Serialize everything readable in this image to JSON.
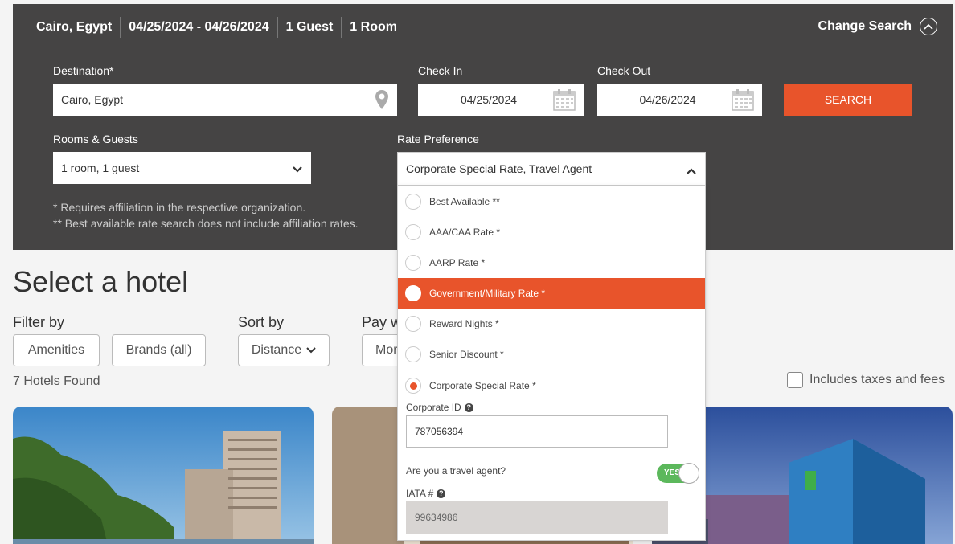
{
  "summary": {
    "location": "Cairo, Egypt",
    "dates": "04/25/2024 - 04/26/2024",
    "guests": "1 Guest",
    "rooms": "1 Room",
    "change_search": "Change Search"
  },
  "form": {
    "destination_label": "Destination*",
    "destination_value": "Cairo, Egypt",
    "checkin_label": "Check In",
    "checkin_value": "04/25/2024",
    "checkout_label": "Check Out",
    "checkout_value": "04/26/2024",
    "search_button": "SEARCH",
    "rooms_label": "Rooms & Guests",
    "rooms_value": "1 room, 1 guest",
    "rate_label": "Rate Preference",
    "rate_value": "Corporate Special Rate, Travel Agent",
    "note1": "* Requires affiliation in the respective organization.",
    "note2": "** Best available rate search does not include affiliation rates."
  },
  "rate_options": [
    {
      "label": "Best Available **",
      "state": "unchecked"
    },
    {
      "label": "AAA/CAA Rate *",
      "state": "unchecked"
    },
    {
      "label": "AARP Rate *",
      "state": "unchecked"
    },
    {
      "label": "Government/Military Rate *",
      "state": "highlighted"
    },
    {
      "label": "Reward Nights *",
      "state": "unchecked"
    },
    {
      "label": "Senior Discount *",
      "state": "unchecked"
    },
    {
      "label": "Corporate Special Rate *",
      "state": "checked"
    }
  ],
  "corporate": {
    "id_label": "Corporate ID",
    "id_value": "787056394",
    "agent_question": "Are you a travel agent?",
    "agent_toggle": "YES",
    "iata_label": "IATA #",
    "iata_value": "99634986"
  },
  "page": {
    "title": "Select a hotel",
    "filter_by": "Filter by",
    "amenities": "Amenities",
    "brands": "Brands (all)",
    "sort_by": "Sort by",
    "sort_value": "Distance",
    "pay_with": "Pay w",
    "pay_value": "Mor",
    "hotels_found": "7 Hotels Found",
    "taxes_label": "Includes taxes and fees"
  },
  "colors": {
    "accent": "#e8542b",
    "panel": "#454444",
    "toggle_on": "#5cb85c"
  }
}
